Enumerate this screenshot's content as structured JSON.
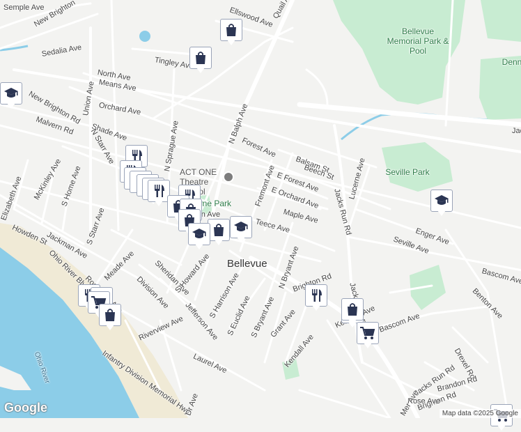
{
  "map": {
    "logo": "Google",
    "attribution": "Map data ©2025 Google",
    "colors": {
      "water": "#8ccde8",
      "park": "#c8ecd2",
      "road": "#ffffff",
      "major_road": "#ffffff",
      "land": "#f3f3f1",
      "marker_icon": "#2b3553"
    }
  },
  "labels": [
    {
      "text": "Semple Ave"
    },
    {
      "text": "New Brighton"
    },
    {
      "text": "Sedalia Ave"
    },
    {
      "text": "Tingley Ave"
    },
    {
      "text": "Quail Ave"
    },
    {
      "text": "Ellswood Ave"
    },
    {
      "text": "North Ave"
    },
    {
      "text": "Means Ave"
    },
    {
      "text": "New Brighton Rd"
    },
    {
      "text": "Orchard Ave"
    },
    {
      "text": "Malvern Rd"
    },
    {
      "text": "Shade Ave"
    },
    {
      "text": "N Starr Ave"
    },
    {
      "text": "Union Ave"
    },
    {
      "text": "N Sprague Ave"
    },
    {
      "text": "N Balph Ave"
    },
    {
      "text": "Forest Ave"
    },
    {
      "text": "Balsam St"
    },
    {
      "text": "Beech St"
    },
    {
      "text": "E Forest Ave"
    },
    {
      "text": "E Orchard Ave"
    },
    {
      "text": "Fremont Ave"
    },
    {
      "text": "Maple Ave"
    },
    {
      "text": "Teece Ave"
    },
    {
      "text": "Lincoln Ave"
    },
    {
      "text": "McKinley Ave"
    },
    {
      "text": "S Home Ave"
    },
    {
      "text": "Elizabeth Ave"
    },
    {
      "text": "Howden St"
    },
    {
      "text": "S Starr Ave"
    },
    {
      "text": "Jackman Ave"
    },
    {
      "text": "Meade Ave"
    },
    {
      "text": "Ohio River Blvd"
    },
    {
      "text": "Roosevelt Ave"
    },
    {
      "text": "Division Ave"
    },
    {
      "text": "Sheridan Ave"
    },
    {
      "text": "S Howard Ave"
    },
    {
      "text": "S Harrison Ave"
    },
    {
      "text": "Jefferson Ave"
    },
    {
      "text": "Riverview Ave"
    },
    {
      "text": "Infantry Division Memorial Hwy"
    },
    {
      "text": "Laurel Ave"
    },
    {
      "text": "S Euclid Ave"
    },
    {
      "text": "S Bryant Ave"
    },
    {
      "text": "N Bryant Ave"
    },
    {
      "text": "Brighton Rd"
    },
    {
      "text": "Grant Ave"
    },
    {
      "text": "Kendall Ave"
    },
    {
      "text": "Keswick Ave"
    },
    {
      "text": "Jacks Run Rd"
    },
    {
      "text": "Jacks Run Rd"
    },
    {
      "text": "Jacks Run Rd"
    },
    {
      "text": "Jacks"
    },
    {
      "text": "Lucerne Ave"
    },
    {
      "text": "Enger Ave"
    },
    {
      "text": "Seville Ave"
    },
    {
      "text": "Bascom Ave"
    },
    {
      "text": "Benton Ave"
    },
    {
      "text": "Bascom Ave"
    },
    {
      "text": "Drexel Rd"
    },
    {
      "text": "Brandon Rd"
    },
    {
      "text": "Brighton Rd"
    },
    {
      "text": "Rose Ave"
    },
    {
      "text": "Ohio River"
    },
    {
      "text": "Mer Ave"
    },
    {
      "text": "Dr Ave"
    }
  ],
  "parks": [
    {
      "text": "Bellevue Memorial Park & Pool"
    },
    {
      "text": "Seville Park"
    },
    {
      "text": "Denn"
    },
    {
      "text": "Bayne Park"
    }
  ],
  "places": [
    {
      "text": "Bellevue"
    },
    {
      "text": "ACT ONE Theatre School"
    }
  ],
  "markers": [
    {
      "type": "shopping",
      "name": "shopping-bag-marker"
    },
    {
      "type": "shopping",
      "name": "shopping-bag-marker"
    },
    {
      "type": "school",
      "name": "school-marker"
    },
    {
      "type": "restaurant",
      "name": "restaurant-marker"
    },
    {
      "type": "restaurant",
      "name": "restaurant-marker"
    },
    {
      "type": "restaurant",
      "name": "restaurant-marker"
    },
    {
      "type": "restaurant",
      "name": "restaurant-marker"
    },
    {
      "type": "restaurant",
      "name": "restaurant-marker"
    },
    {
      "type": "restaurant",
      "name": "restaurant-marker"
    },
    {
      "type": "restaurant",
      "name": "restaurant-marker"
    },
    {
      "type": "restaurant",
      "name": "restaurant-marker"
    },
    {
      "type": "shopping",
      "name": "shopping-bag-marker"
    },
    {
      "type": "shopping",
      "name": "shopping-bag-marker"
    },
    {
      "type": "school",
      "name": "school-marker"
    },
    {
      "type": "shopping",
      "name": "shopping-bag-marker"
    },
    {
      "type": "school",
      "name": "school-marker"
    },
    {
      "type": "shopping",
      "name": "shopping-bag-marker"
    },
    {
      "type": "school",
      "name": "school-marker"
    },
    {
      "type": "restaurant",
      "name": "restaurant-marker"
    },
    {
      "type": "restaurant",
      "name": "restaurant-marker"
    },
    {
      "type": "grocery",
      "name": "grocery-cart-marker"
    },
    {
      "type": "shopping",
      "name": "shopping-bag-marker"
    },
    {
      "type": "restaurant",
      "name": "restaurant-marker"
    },
    {
      "type": "grocery",
      "name": "grocery-cart-marker"
    },
    {
      "type": "shopping",
      "name": "shopping-bag-marker"
    },
    {
      "type": "grocery",
      "name": "grocery-cart-marker"
    },
    {
      "type": "grocery",
      "name": "grocery-cart-marker"
    }
  ]
}
